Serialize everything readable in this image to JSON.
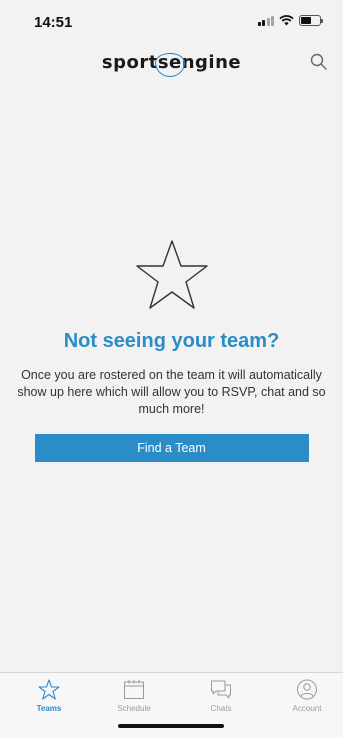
{
  "status_bar": {
    "time": "14:51",
    "battery_level": 0.55
  },
  "header": {
    "logo_prefix": "sport",
    "logo_mid": "se",
    "logo_suffix": "ngine",
    "search_icon": "search-icon"
  },
  "empty_state": {
    "icon": "star-outline-icon",
    "title": "Not seeing your team?",
    "body": "Once you are rostered on the team it will automatically show up here which will allow you to RSVP, chat and so much more!",
    "button_label": "Find a Team"
  },
  "tabs": [
    {
      "label": "Teams",
      "icon": "star-icon",
      "active": true
    },
    {
      "label": "Schedule",
      "icon": "calendar-icon",
      "active": false
    },
    {
      "label": "Chats",
      "icon": "chat-icon",
      "active": false
    },
    {
      "label": "Account",
      "icon": "account-icon",
      "active": false
    }
  ],
  "colors": {
    "accent": "#2a8dc8",
    "background": "#f2f2f2",
    "tab_inactive": "#9a9a9a"
  }
}
